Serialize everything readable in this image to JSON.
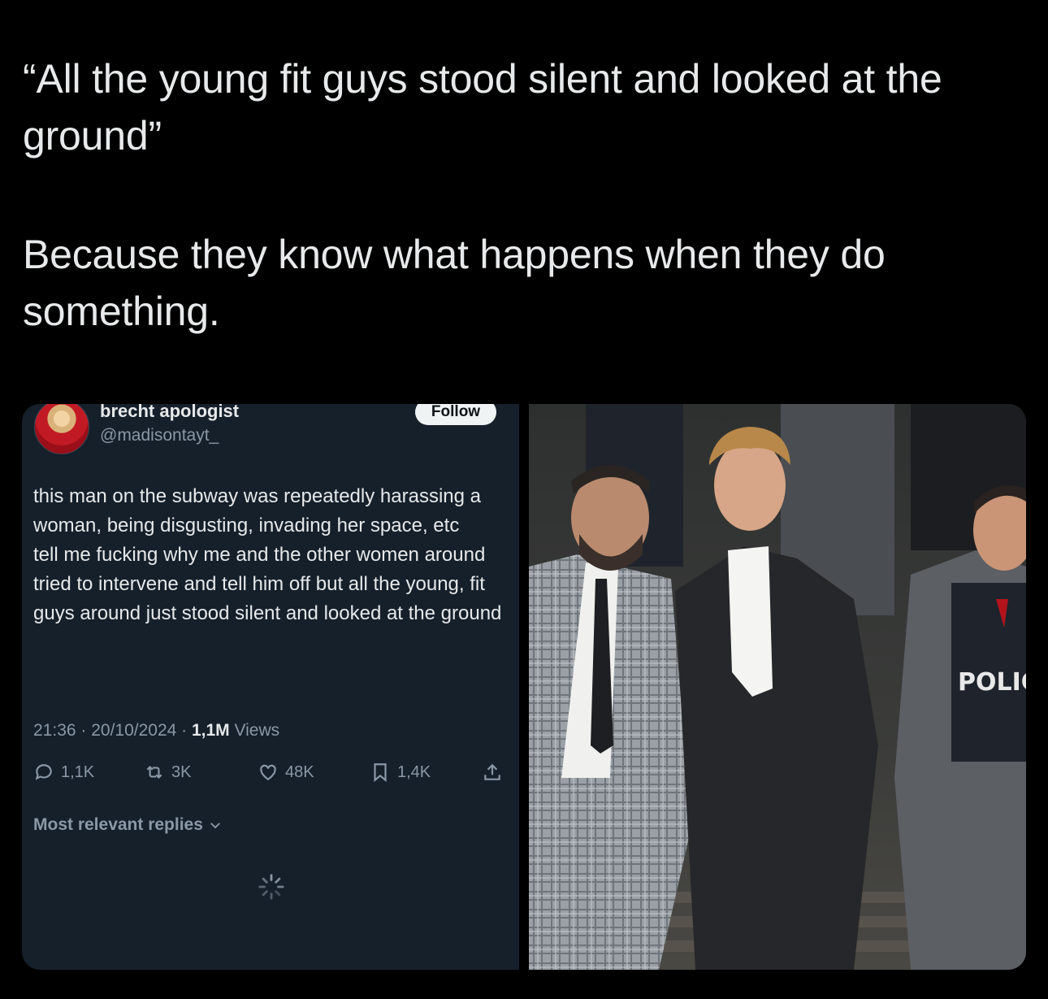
{
  "post": {
    "paragraph1": "“All the young fit guys stood silent and looked at the ground”",
    "paragraph2": "Because they know what happens when they do something."
  },
  "embedded_tweet": {
    "display_name": "brecht apologist",
    "handle": "@madisontayt_",
    "follow_label": "Follow",
    "text": "this man on the subway was repeatedly harassing a woman, being disgusting, invading her space, etc\ntell me fucking why me and the other women around tried to intervene and tell him off but all the young, fit guys around just stood silent and looked at the ground",
    "timestamp": "21:36 · 20/10/2024 · ",
    "views_count": "1,1M",
    "views_label": " Views",
    "replies": "1,1K",
    "reposts": "3K",
    "likes": "48K",
    "bookmarks": "1,4K",
    "most_relevant_label": "Most relevant replies",
    "icons": [
      "reply-icon",
      "repost-icon",
      "like-icon",
      "bookmark-icon",
      "share-icon",
      "chevron-down-icon",
      "loading-spinner-icon"
    ]
  },
  "photo": {
    "vest_text": "POLIC",
    "description_icon": "photo"
  },
  "colors": {
    "background": "#000000",
    "tweet_bg": "#15202b",
    "text_primary": "#e7e9ea",
    "text_secondary": "#8b98a5"
  }
}
